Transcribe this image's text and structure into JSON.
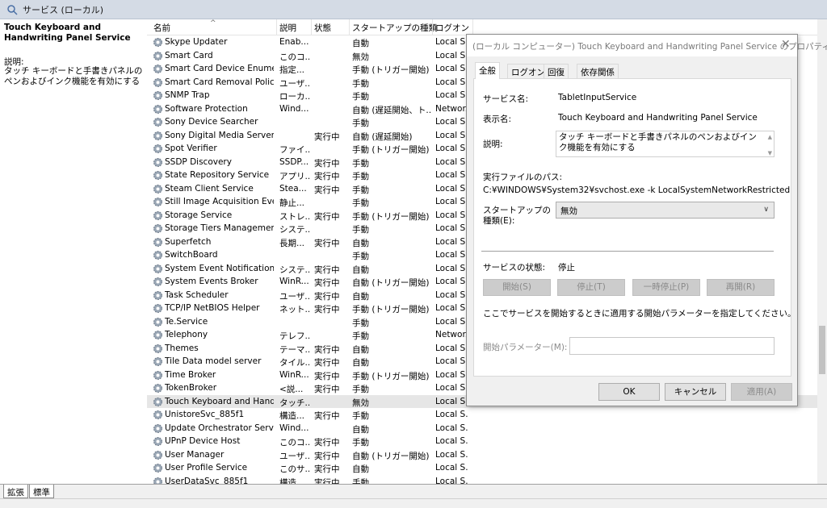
{
  "window": {
    "title": "サービス (ローカル)",
    "icon": "search-icon"
  },
  "left_pane": {
    "service_title": "Touch Keyboard and Handwriting Panel Service",
    "desc_label": "説明:",
    "desc_text": "タッチ キーボードと手書きパネルのペンおよびインク機能を有効にする"
  },
  "columns": {
    "name": "名前",
    "desc": "説明",
    "status": "状態",
    "startup": "スタートアップの種類",
    "logon": "ログオン"
  },
  "services": [
    {
      "name": "Skype Updater",
      "desc": "Enab...",
      "status": "",
      "startup": "自動",
      "logon": "Local S..."
    },
    {
      "name": "Smart Card",
      "desc": "このコ...",
      "status": "",
      "startup": "無効",
      "logon": "Local S..."
    },
    {
      "name": "Smart Card Device Enumera...",
      "desc": "指定...",
      "status": "",
      "startup": "手動 (トリガー開始)",
      "logon": "Local S..."
    },
    {
      "name": "Smart Card Removal Policy",
      "desc": "ユーザ...",
      "status": "",
      "startup": "手動",
      "logon": "Local S..."
    },
    {
      "name": "SNMP Trap",
      "desc": "ローカ...",
      "status": "",
      "startup": "手動",
      "logon": "Local S..."
    },
    {
      "name": "Software Protection",
      "desc": "Wind...",
      "status": "",
      "startup": "自動 (遅延開始、ト...",
      "logon": "Networ..."
    },
    {
      "name": "Sony Device Searcher",
      "desc": "",
      "status": "",
      "startup": "手動",
      "logon": "Local S..."
    },
    {
      "name": "Sony Digital Media Server",
      "desc": "",
      "status": "実行中",
      "startup": "自動 (遅延開始)",
      "logon": "Local S..."
    },
    {
      "name": "Spot Verifier",
      "desc": "ファイ...",
      "status": "",
      "startup": "手動 (トリガー開始)",
      "logon": "Local S..."
    },
    {
      "name": "SSDP Discovery",
      "desc": "SSDP...",
      "status": "実行中",
      "startup": "手動",
      "logon": "Local S..."
    },
    {
      "name": "State Repository Service",
      "desc": "アプリ...",
      "status": "実行中",
      "startup": "手動",
      "logon": "Local S..."
    },
    {
      "name": "Steam Client Service",
      "desc": "Stea...",
      "status": "実行中",
      "startup": "手動",
      "logon": "Local S..."
    },
    {
      "name": "Still Image Acquisition Events",
      "desc": "静止...",
      "status": "",
      "startup": "手動",
      "logon": "Local S..."
    },
    {
      "name": "Storage Service",
      "desc": "ストレ...",
      "status": "実行中",
      "startup": "手動 (トリガー開始)",
      "logon": "Local S..."
    },
    {
      "name": "Storage Tiers Management",
      "desc": "システ...",
      "status": "",
      "startup": "手動",
      "logon": "Local S..."
    },
    {
      "name": "Superfetch",
      "desc": "長期...",
      "status": "実行中",
      "startup": "自動",
      "logon": "Local S..."
    },
    {
      "name": "SwitchBoard",
      "desc": "",
      "status": "",
      "startup": "手動",
      "logon": "Local S..."
    },
    {
      "name": "System Event Notification S...",
      "desc": "システ...",
      "status": "実行中",
      "startup": "自動",
      "logon": "Local S..."
    },
    {
      "name": "System Events Broker",
      "desc": "WinR...",
      "status": "実行中",
      "startup": "自動 (トリガー開始)",
      "logon": "Local S..."
    },
    {
      "name": "Task Scheduler",
      "desc": "ユーザ...",
      "status": "実行中",
      "startup": "自動",
      "logon": "Local S..."
    },
    {
      "name": "TCP/IP NetBIOS Helper",
      "desc": "ネット...",
      "status": "実行中",
      "startup": "手動 (トリガー開始)",
      "logon": "Local S..."
    },
    {
      "name": "Te.Service",
      "desc": "",
      "status": "",
      "startup": "手動",
      "logon": "Local S..."
    },
    {
      "name": "Telephony",
      "desc": "テレフ...",
      "status": "",
      "startup": "手動",
      "logon": "Networ..."
    },
    {
      "name": "Themes",
      "desc": "テーマ...",
      "status": "実行中",
      "startup": "自動",
      "logon": "Local S..."
    },
    {
      "name": "Tile Data model server",
      "desc": "タイル...",
      "status": "実行中",
      "startup": "自動",
      "logon": "Local S..."
    },
    {
      "name": "Time Broker",
      "desc": "WinR...",
      "status": "実行中",
      "startup": "手動 (トリガー開始)",
      "logon": "Local S..."
    },
    {
      "name": "TokenBroker",
      "desc": "<説...",
      "status": "実行中",
      "startup": "手動",
      "logon": "Local S..."
    },
    {
      "name": "Touch Keyboard and Hand...",
      "desc": "タッチ...",
      "status": "",
      "startup": "無効",
      "logon": "Local S...",
      "selected": true
    },
    {
      "name": "UnistoreSvc_885f1",
      "desc": "構造...",
      "status": "実行中",
      "startup": "手動",
      "logon": "Local S..."
    },
    {
      "name": "Update Orchestrator Service",
      "desc": "Wind...",
      "status": "",
      "startup": "自動",
      "logon": "Local S..."
    },
    {
      "name": "UPnP Device Host",
      "desc": "このコ...",
      "status": "実行中",
      "startup": "手動",
      "logon": "Local S..."
    },
    {
      "name": "User Manager",
      "desc": "ユーザ...",
      "status": "実行中",
      "startup": "自動 (トリガー開始)",
      "logon": "Local S..."
    },
    {
      "name": "User Profile Service",
      "desc": "このサ...",
      "status": "実行中",
      "startup": "自動",
      "logon": "Local S..."
    },
    {
      "name": "UserDataSvc_885f1",
      "desc": "構造...",
      "status": "実行中",
      "startup": "手動",
      "logon": "Local S..."
    }
  ],
  "bottom_tabs": {
    "extended": "拡張",
    "standard": "標準"
  },
  "dialog": {
    "title": "(ローカル コンピューター) Touch Keyboard and Handwriting Panel Service のプロパティ",
    "close": "✕",
    "tabs": {
      "general": "全般",
      "logon": "ログオン",
      "recovery": "回復",
      "dependencies": "依存関係"
    },
    "service_name_label": "サービス名:",
    "service_name": "TabletInputService",
    "display_name_label": "表示名:",
    "display_name": "Touch Keyboard and Handwriting Panel Service",
    "description_label": "説明:",
    "description": "タッチ キーボードと手書きパネルのペンおよびインク機能を有効にする",
    "exe_path_label": "実行ファイルのパス:",
    "exe_path": "C:¥WINDOWS¥System32¥svchost.exe -k LocalSystemNetworkRestricted",
    "startup_type_label_1": "スタートアップの",
    "startup_type_label_2": "種類(E):",
    "startup_type_value": "無効",
    "status_label": "サービスの状態:",
    "status_value": "停止",
    "buttons": {
      "start": "開始(S)",
      "stop": "停止(T)",
      "pause": "一時停止(P)",
      "resume": "再開(R)"
    },
    "params_note": "ここでサービスを開始するときに適用する開始パラメーターを指定してください。",
    "params_label": "開始パラメーター(M):",
    "params_value": "",
    "ok": "OK",
    "cancel": "キャンセル",
    "apply": "適用(A)"
  }
}
